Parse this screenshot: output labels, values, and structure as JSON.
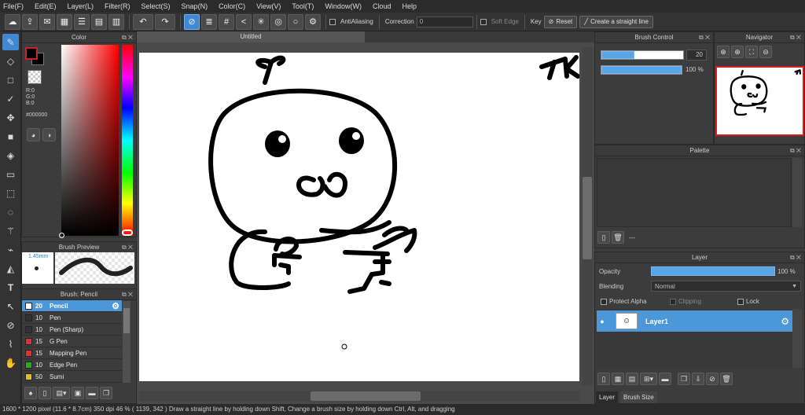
{
  "menu": [
    "File(F)",
    "Edit(E)",
    "Layer(L)",
    "Filter(R)",
    "Select(S)",
    "Snap(N)",
    "Color(C)",
    "View(V)",
    "Tool(T)",
    "Window(W)",
    "Cloud",
    "Help"
  ],
  "toolbar": {
    "antialiasing_label": "AntiAliasing",
    "correction_label": "Correction",
    "correction_value": "0",
    "soft_edge_label": "Soft Edge",
    "key_label": "Key",
    "reset_label": "Reset",
    "straight_line_label": "Create a straight line"
  },
  "color_panel": {
    "title": "Color",
    "r": "R:0",
    "g": "G:0",
    "b": "B:0",
    "hex": "#000000",
    "foreground": "#000000",
    "background": "#000000"
  },
  "brush_preview": {
    "title": "Brush Preview",
    "size": "1.45mm"
  },
  "brush_list": {
    "title": "Brush: Pencil",
    "items": [
      {
        "size": "20",
        "name": "Pencil",
        "color": "#ffffff",
        "selected": true
      },
      {
        "size": "10",
        "name": "Pen",
        "color": "#333333"
      },
      {
        "size": "10",
        "name": "Pen (Sharp)",
        "color": "#333333"
      },
      {
        "size": "15",
        "name": "G Pen",
        "color": "#e03030"
      },
      {
        "size": "15",
        "name": "Mapping Pen",
        "color": "#e03030"
      },
      {
        "size": "10",
        "name": "Edge Pen",
        "color": "#20b020"
      },
      {
        "size": "50",
        "name": "Sumi",
        "color": "#e0c020"
      }
    ]
  },
  "canvas": {
    "tab_title": "Untitled"
  },
  "brush_control": {
    "title": "Brush Control",
    "size_value": "20",
    "opacity_value": "100 %",
    "size_fraction": 0.4,
    "opacity_fraction": 1.0
  },
  "navigator": {
    "title": "Navigator"
  },
  "palette": {
    "title": "Palette",
    "footer_text": "---"
  },
  "layer_panel": {
    "title": "Layer",
    "opacity_label": "Opacity",
    "opacity_value": "100 %",
    "blending_label": "Blending",
    "blending_value": "Normal",
    "protect_alpha": "Protect Alpha",
    "clipping": "Clipping",
    "lock": "Lock",
    "layers": [
      {
        "name": "Layer1",
        "selected": true
      }
    ],
    "tab_layer": "Layer",
    "tab_brush_size": "Brush Size"
  },
  "status_bar": {
    "text": "1600 * 1200 pixel   (11.6 * 8.7cm)   350 dpi   46 %   ( 1139, 342 )   Draw a straight line by holding down Shift, Change a brush size by holding down Ctrl, Alt, and dragging"
  }
}
